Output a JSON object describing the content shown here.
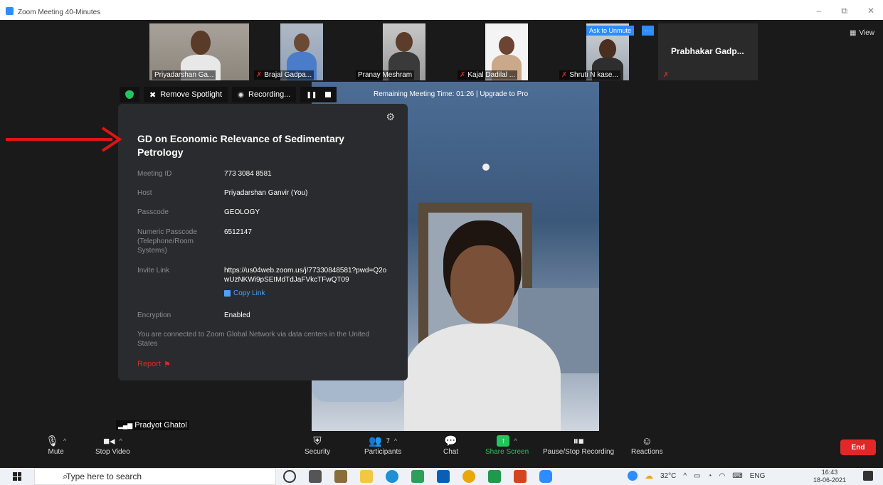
{
  "window": {
    "title": "Zoom Meeting 40-Minutes",
    "minimize": "–",
    "restore": "⧉",
    "close": "✕"
  },
  "view_label": "View",
  "participants": [
    {
      "name": "Priyadarshan Ga...",
      "muted": false
    },
    {
      "name": "Brajal Gadpa...",
      "muted": true
    },
    {
      "name": "Pranay Meshram",
      "muted": false
    },
    {
      "name": "Kajal Dadilal ...",
      "muted": true
    },
    {
      "name": "Shruti N kase...",
      "muted": true
    },
    {
      "name": "Prabhakar  Gadp...",
      "muted": true
    }
  ],
  "ask_to_unmute": "Ask to Unmute",
  "more_btn": "···",
  "topbar": {
    "remove_spotlight": "Remove Spotlight",
    "recording": "Recording...",
    "remaining": "Remaining Meeting Time: 01:26 | Upgrade to Pro"
  },
  "info": {
    "title": "GD on Economic Relevance of Sedimentary Petrology",
    "meeting_id_label": "Meeting ID",
    "meeting_id": "773 3084 8581",
    "host_label": "Host",
    "host": "Priyadarshan Ganvir (You)",
    "passcode_label": "Passcode",
    "passcode": "GEOLOGY",
    "numeric_label": "Numeric Passcode (Telephone/Room Systems)",
    "numeric": "6512147",
    "invite_label": "Invite Link",
    "invite": "https://us04web.zoom.us/j/77330848581?pwd=Q2owUzNKWi9pSEtMdTdJaFVkcTFwQT09",
    "copy_link": "Copy Link",
    "encryption_label": "Encryption",
    "encryption": "Enabled",
    "note": "You are connected to Zoom Global Network via data centers in the United States",
    "report": "Report"
  },
  "speaker_tag": "Pradyot Ghatol",
  "controls": {
    "mute": "Mute",
    "stop_video": "Stop Video",
    "security": "Security",
    "participants": "Participants",
    "participants_count": "7",
    "chat": "Chat",
    "share": "Share Screen",
    "pause_rec": "Pause/Stop Recording",
    "reactions": "Reactions",
    "end": "End"
  },
  "taskbar": {
    "search_placeholder": "Type here to search",
    "temp": "32°C",
    "lang": "ENG",
    "time": "16:43",
    "date": "18-06-2021"
  },
  "colors": {
    "accent": "#2d8cff",
    "end": "#e02828",
    "share": "#23c55e",
    "arrow": "#e01414"
  }
}
